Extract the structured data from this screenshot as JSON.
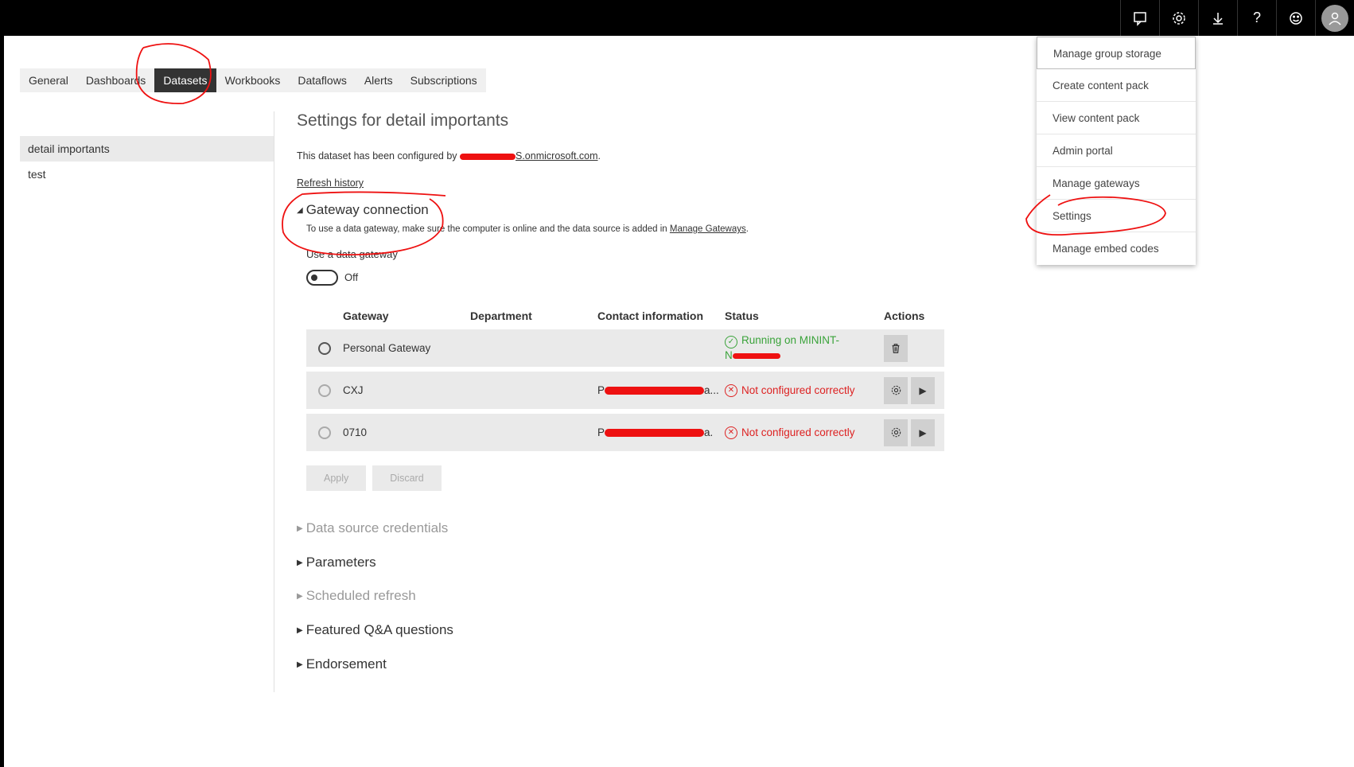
{
  "tabs": [
    {
      "label": "General"
    },
    {
      "label": "Dashboards"
    },
    {
      "label": "Datasets"
    },
    {
      "label": "Workbooks"
    },
    {
      "label": "Dataflows"
    },
    {
      "label": "Alerts"
    },
    {
      "label": "Subscriptions"
    }
  ],
  "sidenav": {
    "items": [
      {
        "label": "detail importants"
      },
      {
        "label": "test"
      }
    ]
  },
  "main": {
    "title": "Settings for detail importants",
    "configured_prefix": "This dataset has been configured by ",
    "configured_email_visible": "S.onmicrosoft.com",
    "configured_suffix": ".",
    "refresh_history": "Refresh history",
    "gateway_section": "Gateway connection",
    "gateway_desc": "To use a data gateway, make sure the computer is online and the data source is added in ",
    "manage_gateways_link": "Manage Gateways",
    "gateway_desc_end": ".",
    "use_gateway_label": "Use a data gateway",
    "toggle_label": "Off",
    "table": {
      "headers": [
        "Gateway",
        "Department",
        "Contact information",
        "Status",
        "Actions"
      ],
      "rows": [
        {
          "gateway": "Personal Gateway",
          "department": "",
          "contact": "",
          "status_line1": "Running on MININT-",
          "status_line2": "N"
        },
        {
          "gateway": "CXJ",
          "department": "",
          "contact_prefix": "P",
          "contact_suffix": "a...",
          "status": "Not configured correctly"
        },
        {
          "gateway": "0710",
          "department": "",
          "contact_prefix": "P",
          "contact_suffix": "a.",
          "status": "Not configured correctly"
        }
      ]
    },
    "apply": "Apply",
    "discard": "Discard",
    "sections": [
      {
        "label": "Data source credentials"
      },
      {
        "label": "Parameters"
      },
      {
        "label": "Scheduled refresh"
      },
      {
        "label": "Featured Q&A questions"
      },
      {
        "label": "Endorsement"
      }
    ]
  },
  "dropdown": {
    "items": [
      {
        "label": "Manage group storage"
      },
      {
        "label": "Create content pack"
      },
      {
        "label": "View content pack"
      },
      {
        "label": "Admin portal"
      },
      {
        "label": "Manage gateways"
      },
      {
        "label": "Settings"
      },
      {
        "label": "Manage embed codes"
      }
    ]
  },
  "topbar_icons": [
    "notifications-icon",
    "gear-icon",
    "download-icon",
    "help-icon",
    "feedback-icon",
    "account-icon"
  ],
  "colors": {
    "ok": "#3aa33a",
    "error": "#dd2222",
    "annotation": "#e11111"
  }
}
